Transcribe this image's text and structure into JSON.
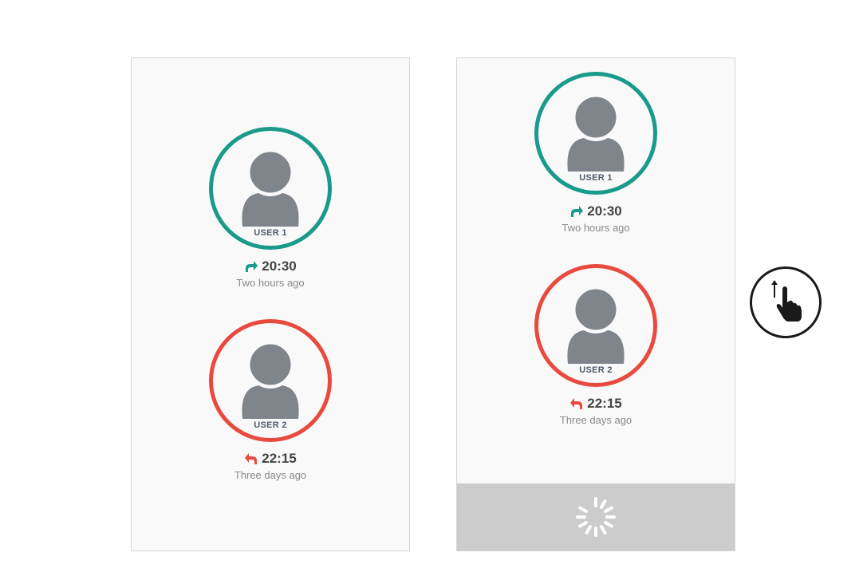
{
  "left_panel": {
    "users": [
      {
        "name": "USER 1",
        "time": "20:30",
        "ago": "Two hours ago",
        "direction": "outgoing-arrow-icon",
        "color": "#1a9a8a"
      },
      {
        "name": "USER 2",
        "time": "22:15",
        "ago": "Three days ago",
        "direction": "reply-arrow-icon",
        "color": "#e94a3f"
      }
    ]
  },
  "right_panel": {
    "users": [
      {
        "name": "USER 1",
        "time": "20:30",
        "ago": "Two hours ago",
        "direction": "outgoing-arrow-icon",
        "color": "#1a9a8a"
      },
      {
        "name": "USER 2",
        "time": "22:15",
        "ago": "Three days ago",
        "direction": "reply-arrow-icon",
        "color": "#e94a3f"
      }
    ],
    "loading_icon": "spinner-icon"
  },
  "gesture_icon": "swipe-up-hand-icon"
}
